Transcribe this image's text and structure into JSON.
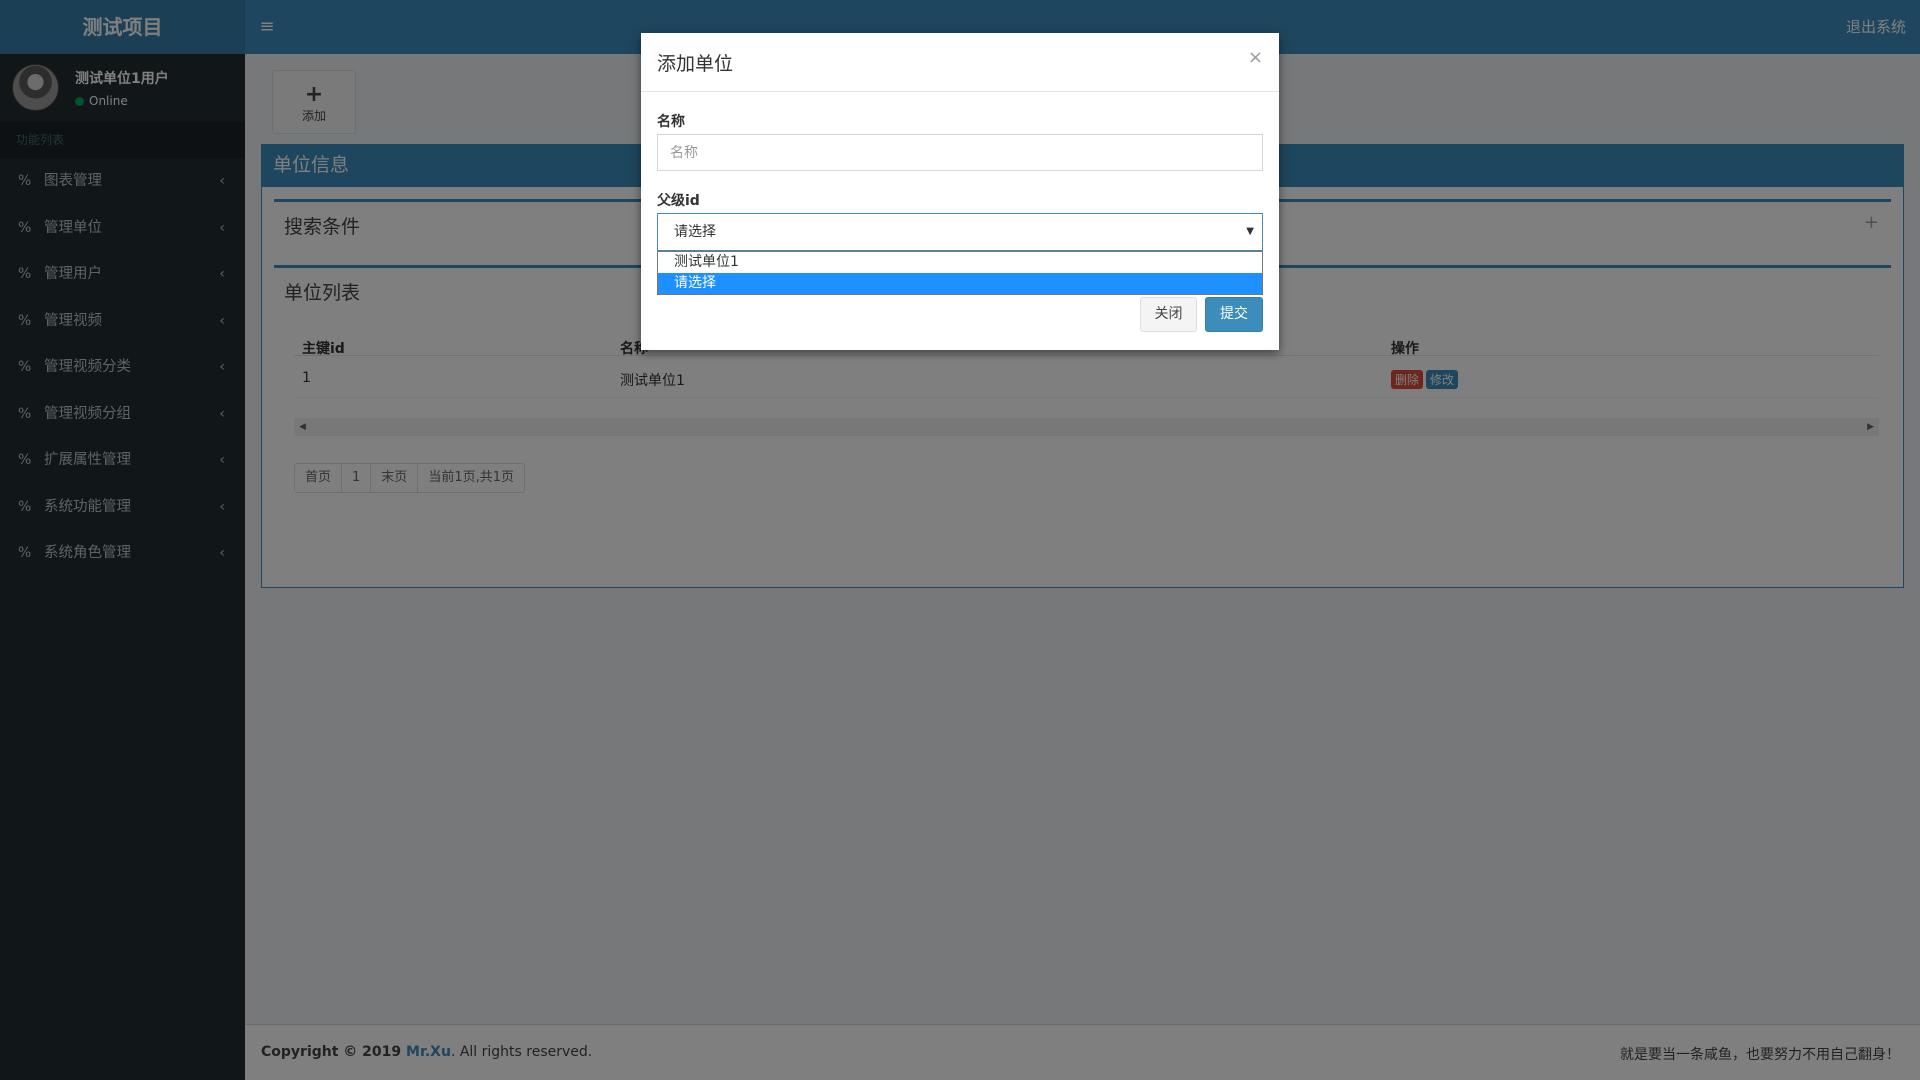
{
  "header": {
    "logo": "测试项目",
    "menu_icon": "hamburger-icon",
    "logout": "退出系统"
  },
  "sidebar": {
    "user_name": "测试单位1用户",
    "user_status": "Online",
    "menu_header": "功能列表",
    "items": [
      {
        "label": "图表管理"
      },
      {
        "label": "管理单位"
      },
      {
        "label": "管理用户"
      },
      {
        "label": "管理视频"
      },
      {
        "label": "管理视频分类"
      },
      {
        "label": "管理视频分组"
      },
      {
        "label": "扩展属性管理"
      },
      {
        "label": "系统功能管理"
      },
      {
        "label": "系统角色管理"
      }
    ]
  },
  "toolbar": {
    "add_label": "添加"
  },
  "main": {
    "box_title": "单位信息",
    "search_title": "搜索条件",
    "list_title": "单位列表",
    "columns": [
      "主键id",
      "名称",
      "操作"
    ],
    "rows": [
      {
        "id": "1",
        "name": "测试单位1",
        "delete_label": "删除",
        "edit_label": "修改"
      }
    ],
    "pager": {
      "first": "首页",
      "page": "1",
      "last": "末页",
      "info": "当前1页,共1页"
    }
  },
  "footer": {
    "copyright_prefix": "Copyright © 2019 ",
    "brand": "Mr.Xu",
    "copyright_suffix": ". All rights reserved.",
    "slogan": "就是要当一条咸鱼，也要努力不用自己翻身！"
  },
  "modal": {
    "title": "添加单位",
    "close_glyph": "×",
    "name_label": "名称",
    "name_placeholder": "名称",
    "name_value": "",
    "parent_label": "父级id",
    "parent_selected": "请选择",
    "parent_options": [
      "测试单位1",
      "请选择"
    ],
    "close_button": "关闭",
    "submit_button": "提交"
  },
  "colors": {
    "primary": "#3c8dbc",
    "sidebar_bg": "#222d32",
    "danger": "#dd4b39",
    "success": "#00a65a",
    "highlight": "#1e90ff"
  }
}
